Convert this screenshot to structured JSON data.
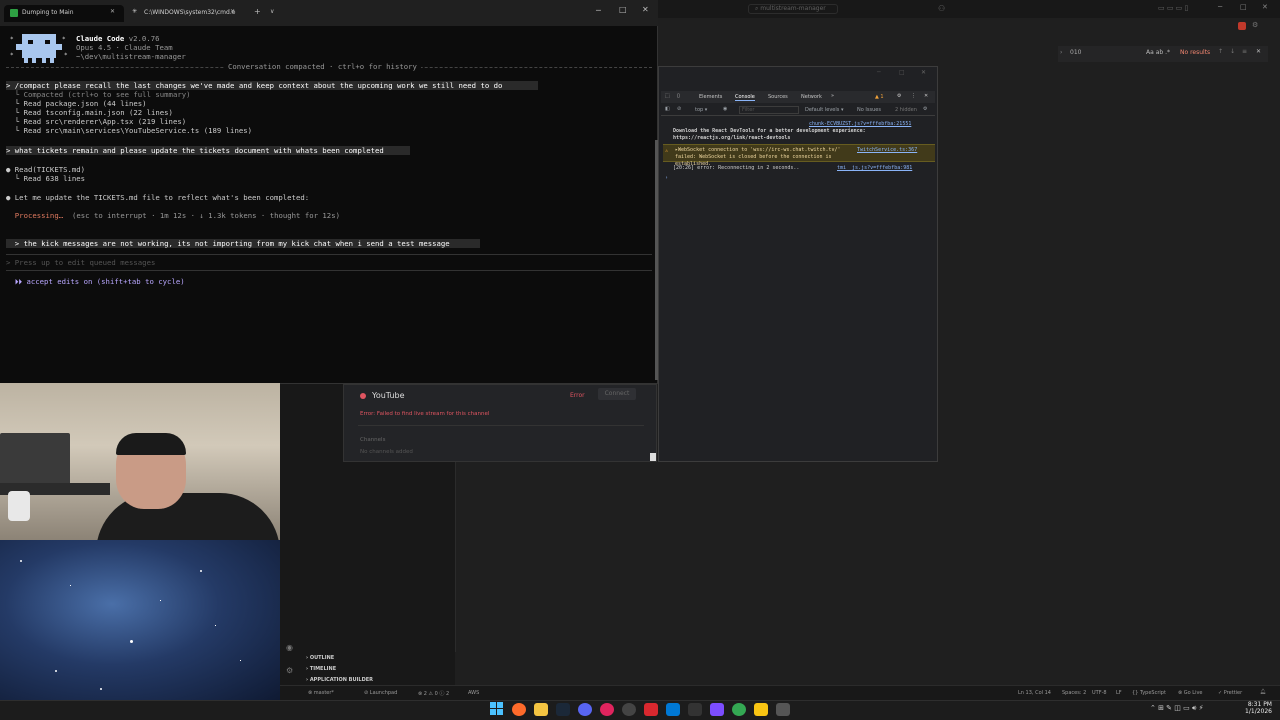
{
  "terminal": {
    "tabs": [
      {
        "label": "Dumping to Main"
      },
      {
        "label": "C:\\WINDOWS\\system32\\cmd.e"
      }
    ],
    "new_tab_glyph": "+",
    "dropdown_glyph": "∨",
    "header": {
      "app_name": "Claude Code",
      "version": "v2.0.76",
      "model": "Opus 4.5 · Claude Team",
      "path": "~\\dev\\multistream-manager"
    },
    "compacted_banner": "Conversation compacted · ctrl+o for history",
    "lines": {
      "compact_cmd": "> /compact please recall the last changes we've made and keep context about the upcoming work we still need to do",
      "compacted_note": "  └ Compacted (ctrl+o to see full summary)",
      "read1": "  └ Read package.json (44 lines)",
      "read2": "  └ Read tsconfig.main.json (22 lines)",
      "read3": "  └ Read src\\renderer\\App.tsx (219 lines)",
      "read4": "  └ Read src\\main\\services\\YouTubeService.ts (189 lines)",
      "prompt2": "> what tickets remain and please update the tickets document with whats been completed",
      "read_tickets": "● Read(TICKETS.md)",
      "read_tickets_result": "  └ Read 638 lines",
      "assistant_msg": "● Let me update the TICKETS.md file to reflect what's been completed:",
      "processing_word": "  Processing…",
      "processing_meta": "(esc to interrupt · 1m 12s · ↓ 1.3k tokens · thought for 12s)",
      "queued_msg": "  > the kick messages are not working, its not importing from my kick chat when i send a test message",
      "input_placeholder": "> Press up to edit queued messages",
      "mode_line": "  ⏵⏵ accept edits on (shift+tab to cycle)"
    }
  },
  "app_panel": {
    "service": "YouTube",
    "status": "Error",
    "connect_label": "Connect",
    "error_text": "Error: Failed to find live stream for this channel",
    "channels_label": "Channels",
    "no_channels": "No channels added"
  },
  "devtools": {
    "tabs": [
      "Elements",
      "Console",
      "Sources",
      "Network",
      "»"
    ],
    "warning_count": "▲ 1",
    "context": "top ▾",
    "filter_placeholder": "Filter",
    "levels": "Default levels ▾",
    "issues": "No Issues",
    "hidden": "2 hidden",
    "messages": {
      "src1": "chunk-ECVBUZST.js?v=fffebfba:21551",
      "react_msg": "Download the React DevTools for a better development experience: https://reactjs.org/link/react-devtools",
      "ws_msg": "▸WebSocket connection to 'wss://irc-ws.chat.twitch.tv/' failed: WebSocket is closed before the connection is established.",
      "ws_src": "TwitchService.ts:367",
      "reconnect_msg": "[20:26] error: Reconnecting in 2 seconds..",
      "reconnect_src": "tmi__js.js?v=fffebfba:981",
      "prompt": "›"
    }
  },
  "vscode": {
    "search_text": "multistream-manager",
    "find_value": "010",
    "find_options": "Aa ab .*",
    "find_result": "No results",
    "sidebar_items": [
      "OUTLINE",
      "TIMELINE",
      "APPLICATION BUILDER"
    ],
    "status_left": [
      "⊗ master*",
      "⊘ Launchpad",
      "⊗ 2 ⚠ 0 ⓘ 2",
      "AWS"
    ],
    "status_right": [
      "Ln 13, Col 14",
      "Spaces: 2",
      "UTF-8",
      "LF",
      "{} TypeScript",
      "⊗ Go Live",
      "✓ Prettier"
    ]
  },
  "taskbar": {
    "time": "8:31 PM",
    "date": "1/1/2026"
  },
  "colors": {
    "accent_purple": "#b9a7ff",
    "processing_orange": "#e07a5f",
    "error_red": "#e05561",
    "warn_bg": "#413a1a"
  }
}
